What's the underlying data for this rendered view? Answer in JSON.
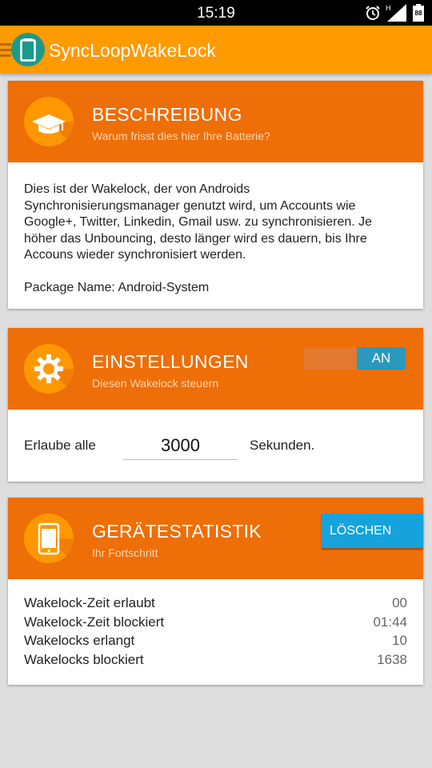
{
  "status_bar": {
    "time": "15:19",
    "network": "H",
    "battery": "88"
  },
  "app_bar": {
    "title": "SyncLoopWakeLock"
  },
  "description_card": {
    "title": "BESCHREIBUNG",
    "subtitle": "Warum frisst dies hier Ihre Batterie?",
    "text": "Dies ist der Wakelock, der von Androids Synchronisierungsmanager genutzt wird, um Accounts wie Google+, Twitter, Linkedin, Gmail usw. zu synchronisieren.  Je höher das Unbouncing, desto länger wird es dauern, bis Ihre Accouns wieder synchronisiert werden.",
    "package": "Package Name: Android-System"
  },
  "settings_card": {
    "title": "EINSTELLUNGEN",
    "subtitle": "Diesen Wakelock steuern",
    "toggle_label": "AN",
    "allow_label": "Erlaube alle",
    "seconds_value": "3000",
    "seconds_label": "Sekunden."
  },
  "stats_card": {
    "title": "GERÄTESTATISTIK",
    "subtitle": "Ihr Fortschritt",
    "delete_label": "LÖSCHEN",
    "rows": [
      {
        "label": "Wakelock-Zeit erlaubt",
        "value": "00"
      },
      {
        "label": "Wakelock-Zeit blockiert",
        "value": "01:44"
      },
      {
        "label": "Wakelocks erlangt",
        "value": "10"
      },
      {
        "label": "Wakelocks blockiert",
        "value": "1638"
      }
    ]
  },
  "colors": {
    "app_bar": "#ff9a00",
    "card_header": "#ee6e08",
    "icon_circle": "#ff9800",
    "toggle_on": "#2b98bd",
    "delete_button": "#16a3dc"
  }
}
